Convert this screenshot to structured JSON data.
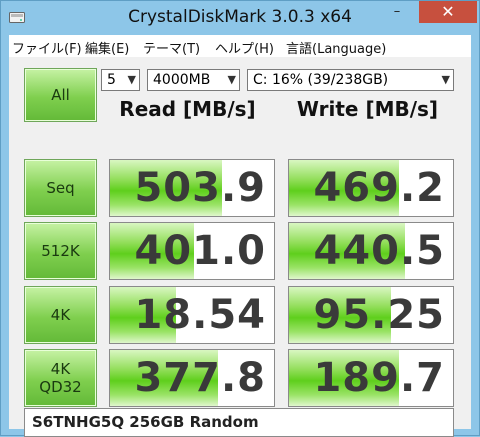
{
  "window": {
    "title": "CrystalDiskMark 3.0.3 x64",
    "minimize_label": "–",
    "maximize_label": "□",
    "close_label": "✕"
  },
  "menu": {
    "items": [
      "ファイル(F)",
      "編集(E)",
      "テーマ(T)",
      "ヘルプ(H)",
      "言語(Language)"
    ]
  },
  "controls": {
    "all_label": "All",
    "count_value": "5",
    "size_value": "4000MB",
    "drive_value": "C: 16% (39/238GB)"
  },
  "headers": {
    "read": "Read [MB/s]",
    "write": "Write [MB/s]"
  },
  "rows": [
    {
      "label": "Seq",
      "label2": "",
      "read": "503.9",
      "write": "469.2",
      "read_fill": 0.68,
      "write_fill": 0.67
    },
    {
      "label": "512K",
      "label2": "",
      "read": "401.0",
      "write": "440.5",
      "read_fill": 0.51,
      "write_fill": 0.71
    },
    {
      "label": "4K",
      "label2": "",
      "read": "18.54",
      "write": "95.25",
      "read_fill": 0.4,
      "write_fill": 0.62
    },
    {
      "label": "4K",
      "label2": "QD32",
      "read": "377.8",
      "write": "189.7",
      "read_fill": 0.66,
      "write_fill": 0.67
    }
  ],
  "comment": "S6TNHG5Q 256GB Random",
  "colors": {
    "accent_green": "#63b938",
    "close_red": "#c7503e",
    "frame_blue": "#8dc6e8"
  }
}
